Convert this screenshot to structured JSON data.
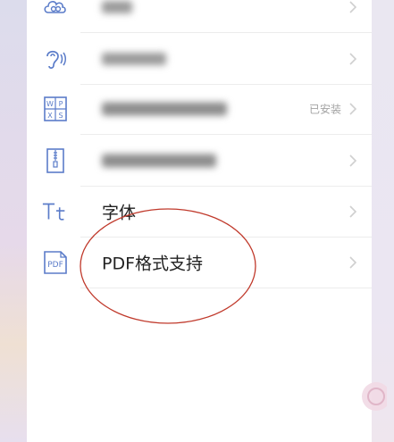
{
  "settings": {
    "items": [
      {
        "icon": "cloud-icon",
        "label": "",
        "status": ""
      },
      {
        "icon": "ear-voice-icon",
        "label": "",
        "status": ""
      },
      {
        "icon": "office-document-icon",
        "label": "",
        "status": "已安装"
      },
      {
        "icon": "zip-archive-icon",
        "label": "",
        "status": ""
      },
      {
        "icon": "font-icon",
        "label": "字体",
        "status": ""
      },
      {
        "icon": "pdf-icon",
        "label": "PDF格式支持",
        "status": ""
      }
    ]
  },
  "colors": {
    "icon_blue": "#5b7cc9",
    "annotation_red": "#c0392b",
    "chevron": "#cfcfcf",
    "status_text": "#a3a3a3"
  }
}
